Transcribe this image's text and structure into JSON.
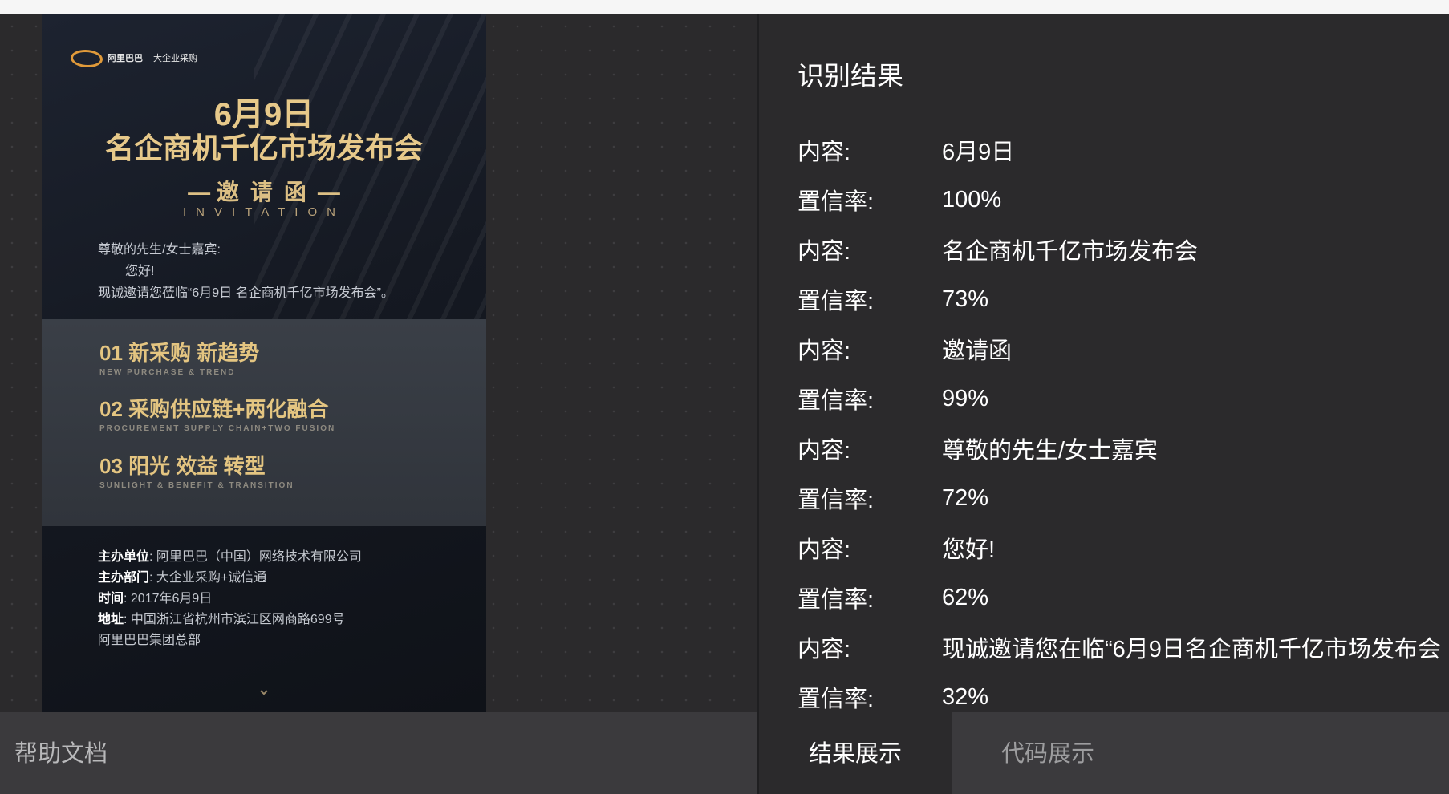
{
  "poster": {
    "logo_brand": "阿里巴巴",
    "logo_sub": "大企业采购",
    "date": "6月9日",
    "title": "名企商机千亿市场发布会",
    "invite": "邀请函",
    "invite_en": "INVITATION",
    "greeting": "尊敬的先生/女士嘉宾:",
    "hello": "您好!",
    "invite_line": "现诚邀请您莅临“6月9日 名企商机千亿市场发布会”。",
    "agenda": [
      {
        "main": "01 新采购  新趋势",
        "sub": "NEW PURCHASE & TREND"
      },
      {
        "main": "02 采购供应链+两化融合",
        "sub": "PROCUREMENT SUPPLY CHAIN+TWO FUSION"
      },
      {
        "main": "03 阳光  效益  转型",
        "sub": "SUNLIGHT & BENEFIT & TRANSITION"
      }
    ],
    "info": [
      {
        "label": "主办单位",
        "value": "阿里巴巴（中国）网络技术有限公司"
      },
      {
        "label": "主办部门",
        "value": "大企业采购+诚信通"
      },
      {
        "label": "时间",
        "value": "2017年6月9日"
      },
      {
        "label": "地址",
        "value": "中国浙江省杭州市滨江区网商路699号"
      },
      {
        "label": "",
        "value": "阿里巴巴集团总部"
      }
    ],
    "arrow": "⌄"
  },
  "results": {
    "heading": "识别结果",
    "content_label": "内容:",
    "confidence_label": "置信率:",
    "items": [
      {
        "content": "6月9日",
        "confidence": "100%"
      },
      {
        "content": "名企商机千亿市场发布会",
        "confidence": "73%"
      },
      {
        "content": "邀请函",
        "confidence": "99%"
      },
      {
        "content": "尊敬的先生/女士嘉宾",
        "confidence": "72%"
      },
      {
        "content": "您好!",
        "confidence": "62%"
      },
      {
        "content": "现诚邀请您在临“6月9日名企商机千亿市场发布会",
        "confidence": "32%"
      }
    ]
  },
  "footer": {
    "help_label": "帮助文档",
    "tabs": [
      {
        "label": "结果展示",
        "active": true
      },
      {
        "label": "代码展示",
        "active": false
      }
    ]
  }
}
